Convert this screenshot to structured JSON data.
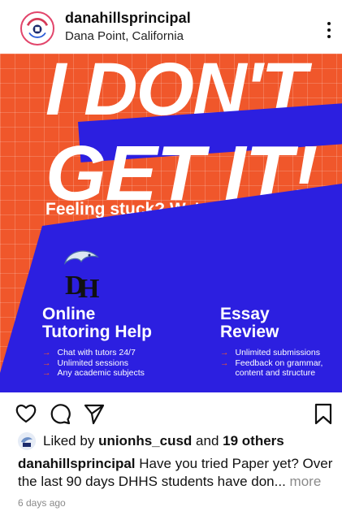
{
  "header": {
    "username": "danahillsprincipal",
    "location": "Dana Point, California"
  },
  "post": {
    "headline_1": "I DON'T",
    "headline_2": "GET IT!",
    "tagline": "Feeling stuck? We've got you!",
    "left_title_1": "Online",
    "left_title_2": "Tutoring Help",
    "left_items": [
      "Chat with tutors 24/7",
      "Unlimited sessions",
      "Any academic subjects"
    ],
    "right_title_1": "Essay",
    "right_title_2": "Review",
    "right_items": [
      "Unlimited submissions",
      "Feedback on grammar,",
      "content and structure"
    ],
    "arrow": "→",
    "colors": {
      "orange": "#f0572b",
      "blue": "#2c1fe0"
    }
  },
  "likes": {
    "prefix": "Liked by",
    "user": "unionhs_cusd",
    "and": "and",
    "others": "19 others"
  },
  "caption": {
    "user": "danahillsprincipal",
    "text": "Have you tried Paper yet? Over the last 90 days DHHS students have don...",
    "more": "more"
  },
  "time": "6 days ago",
  "icons": [
    "heart-icon",
    "comment-icon",
    "share-icon",
    "bookmark-icon",
    "more-options-icon"
  ]
}
